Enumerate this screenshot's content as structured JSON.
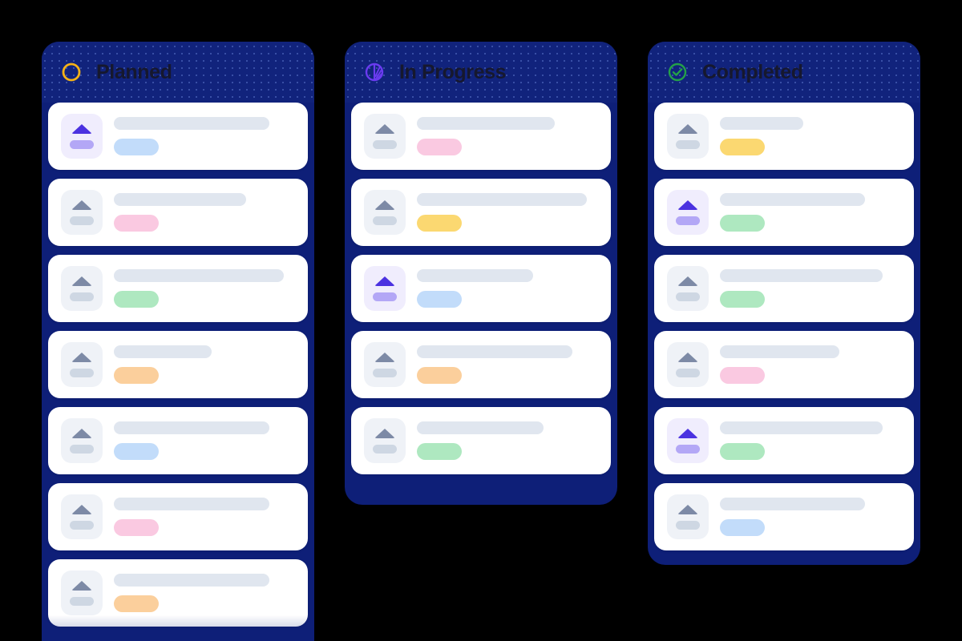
{
  "board": {
    "background_color": "#000000",
    "column_color": "#0E1F78",
    "header_color": "#11237C",
    "title_color": "#16182E",
    "card_color": "#FFFFFF",
    "placeholder_color": "#E0E6EF"
  },
  "tag_colors": {
    "blue": "#C2DCFA",
    "pink": "#FAC9E1",
    "green": "#AEE8C0",
    "orange": "#FBCF9C",
    "yellow": "#FBD871"
  },
  "columns": [
    {
      "id": "planned",
      "title": "Planned",
      "icon": "circle-outline-icon",
      "icon_color": "#F5B217",
      "card_count": 7,
      "clipped": true,
      "cards": [
        {
          "accent": true,
          "title_width": 86,
          "tag_color": "#C2DCFA",
          "tag_width": 56,
          "tag_name": "blue"
        },
        {
          "accent": false,
          "title_width": 73,
          "tag_color": "#FAC9E1",
          "tag_width": 56,
          "tag_name": "pink"
        },
        {
          "accent": false,
          "title_width": 94,
          "tag_color": "#AEE8C0",
          "tag_width": 56,
          "tag_name": "green"
        },
        {
          "accent": false,
          "title_width": 54,
          "tag_color": "#FBCF9C",
          "tag_width": 56,
          "tag_name": "orange"
        },
        {
          "accent": false,
          "title_width": 86,
          "tag_color": "#C2DCFA",
          "tag_width": 56,
          "tag_name": "blue"
        },
        {
          "accent": false,
          "title_width": 86,
          "tag_color": "#FAC9E1",
          "tag_width": 56,
          "tag_name": "pink"
        },
        {
          "accent": false,
          "title_width": 86,
          "tag_color": "#FBCF9C",
          "tag_width": 56,
          "tag_name": "orange"
        }
      ]
    },
    {
      "id": "in-progress",
      "title": "In Progress",
      "icon": "pie-progress-icon",
      "icon_color": "#6A3BF0",
      "card_count": 5,
      "clipped": false,
      "cards": [
        {
          "accent": false,
          "title_width": 76,
          "tag_color": "#FAC9E1",
          "tag_width": 56,
          "tag_name": "pink"
        },
        {
          "accent": false,
          "title_width": 94,
          "tag_color": "#FBD871",
          "tag_width": 56,
          "tag_name": "yellow"
        },
        {
          "accent": true,
          "title_width": 64,
          "tag_color": "#C2DCFA",
          "tag_width": 56,
          "tag_name": "blue"
        },
        {
          "accent": false,
          "title_width": 86,
          "tag_color": "#FBCF9C",
          "tag_width": 56,
          "tag_name": "orange"
        },
        {
          "accent": false,
          "title_width": 70,
          "tag_color": "#AEE8C0",
          "tag_width": 56,
          "tag_name": "green"
        }
      ]
    },
    {
      "id": "completed",
      "title": "Completed",
      "icon": "check-circle-icon",
      "icon_color": "#24A148",
      "card_count": 6,
      "clipped": false,
      "cards": [
        {
          "accent": false,
          "title_width": 46,
          "tag_color": "#FBD871",
          "tag_width": 56,
          "tag_name": "yellow"
        },
        {
          "accent": true,
          "title_width": 80,
          "tag_color": "#AEE8C0",
          "tag_width": 56,
          "tag_name": "green"
        },
        {
          "accent": false,
          "title_width": 90,
          "tag_color": "#AEE8C0",
          "tag_width": 56,
          "tag_name": "green"
        },
        {
          "accent": false,
          "title_width": 66,
          "tag_color": "#FAC9E1",
          "tag_width": 56,
          "tag_name": "pink"
        },
        {
          "accent": true,
          "title_width": 90,
          "tag_color": "#AEE8C0",
          "tag_width": 56,
          "tag_name": "green"
        },
        {
          "accent": false,
          "title_width": 80,
          "tag_color": "#C2DCFA",
          "tag_width": 56,
          "tag_name": "blue"
        }
      ]
    }
  ]
}
